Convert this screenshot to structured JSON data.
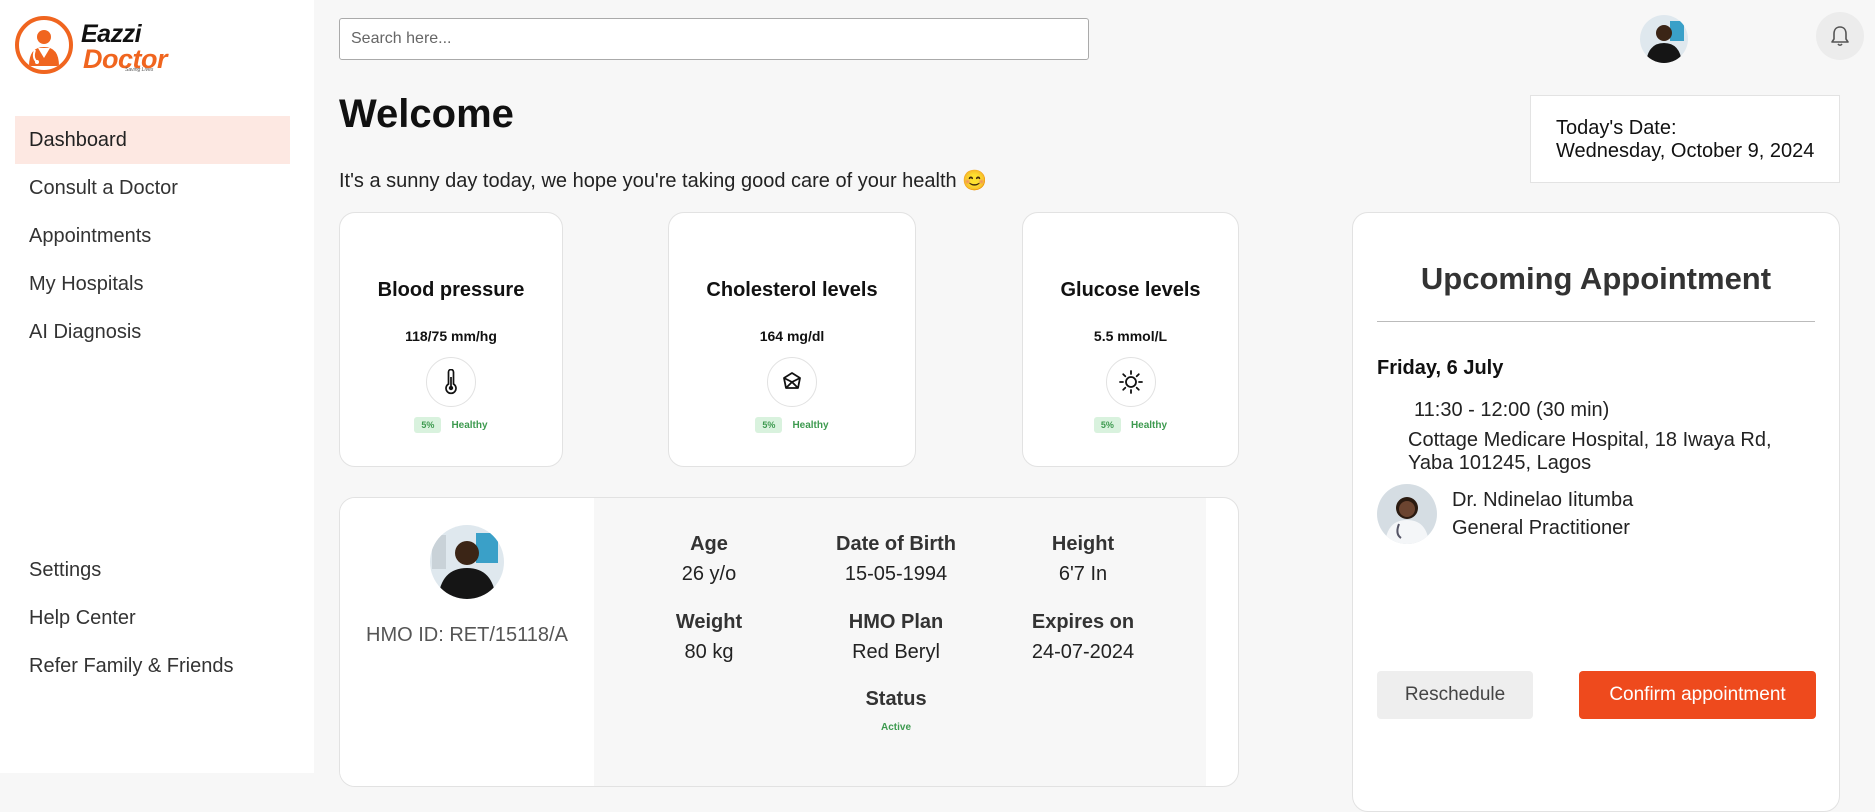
{
  "brand": {
    "name_line1": "Eazzi",
    "name_line2": "Doctor",
    "tagline": "Saving Lives",
    "accent": "#f0651f"
  },
  "sidebar": {
    "items": [
      {
        "label": "Dashboard",
        "active": true
      },
      {
        "label": "Consult a Doctor"
      },
      {
        "label": "Appointments"
      },
      {
        "label": "My Hospitals"
      },
      {
        "label": "AI Diagnosis"
      }
    ],
    "bottom_items": [
      {
        "label": "Settings"
      },
      {
        "label": "Help Center"
      },
      {
        "label": "Refer Family & Friends"
      }
    ]
  },
  "header": {
    "search_placeholder": "Search here...",
    "notification_icon": "bell-icon"
  },
  "main": {
    "title": "Welcome",
    "subtitle": "It's a sunny day today, we hope you're taking good care of your health 😊",
    "date_label": "Today's Date:",
    "date_value": "Wednesday, October 9, 2024"
  },
  "metrics": [
    {
      "title": "Blood pressure",
      "value": "118/75 mm/hg",
      "icon": "thermometer-icon",
      "percent": "5%",
      "status": "Healthy"
    },
    {
      "title": "Cholesterol levels",
      "value": "164 mg/dl",
      "icon": "cube-icon",
      "percent": "5%",
      "status": "Healthy"
    },
    {
      "title": "Glucose levels",
      "value": "5.5 mmol/L",
      "icon": "sun-icon",
      "percent": "5%",
      "status": "Healthy"
    }
  ],
  "profile": {
    "hmo_id": "HMO ID: RET/15118/A",
    "fields": [
      {
        "label": "Age",
        "value": "26 y/o"
      },
      {
        "label": "Date of Birth",
        "value": "15-05-1994"
      },
      {
        "label": "Height",
        "value": "6'7 In"
      },
      {
        "label": "Weight",
        "value": "80 kg"
      },
      {
        "label": "HMO Plan",
        "value": "Red Beryl"
      },
      {
        "label": "Expires on",
        "value": "24-07-2024"
      }
    ],
    "status_label": "Status",
    "status_value": "Active"
  },
  "appointment": {
    "title": "Upcoming Appointment",
    "day": "Friday, 6 July",
    "time": "11:30 - 12:00 (30 min)",
    "location": "Cottage Medicare Hospital, 18 Iwaya Rd, Yaba 101245, Lagos",
    "doctor_name": "Dr. Ndinelao Iitumba",
    "doctor_role": "General Practitioner",
    "reschedule_label": "Reschedule",
    "confirm_label": "Confirm appointment",
    "confirm_color": "#ee4a1d"
  }
}
